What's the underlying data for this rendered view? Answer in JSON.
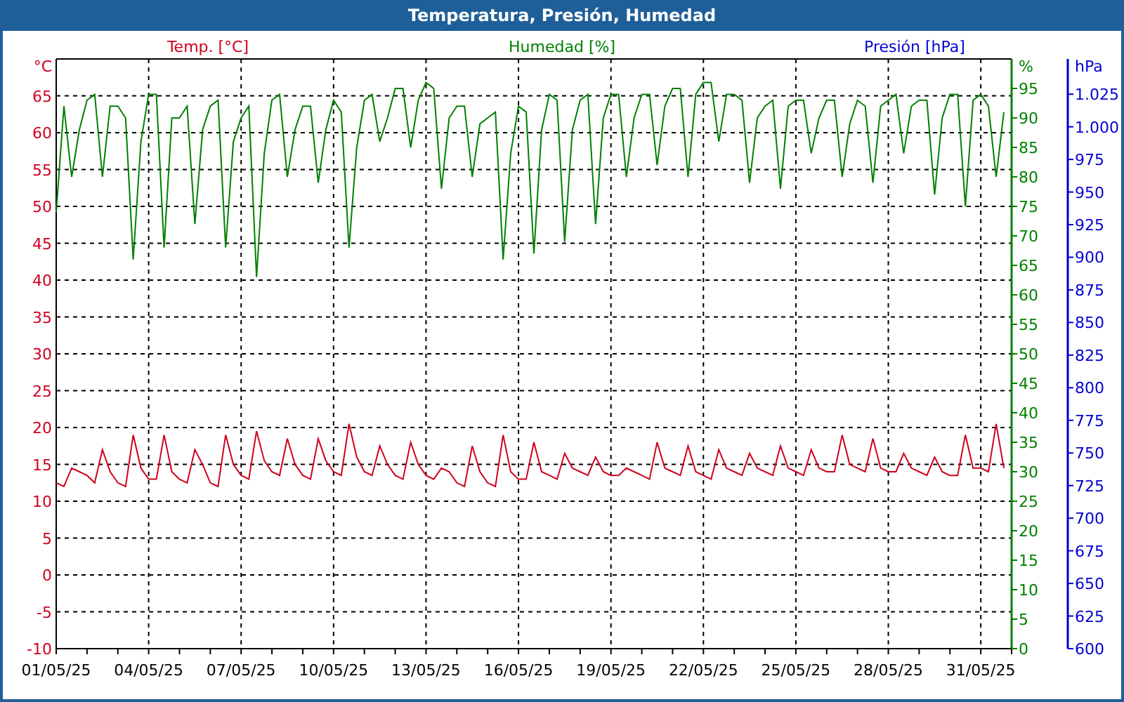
{
  "window": {
    "title": "Temperatura, Presión, Humedad"
  },
  "pressure_title": {
    "text": "Presión [hPa]",
    "color": "#0000d0"
  },
  "chart_data": {
    "type": "line",
    "grid": true,
    "ylabel": "°C",
    "ylim": [
      -10,
      70
    ],
    "y2label": "%",
    "y2lim": [
      0,
      100
    ],
    "y2ticks": [
      0,
      5,
      10,
      15,
      20,
      25,
      30,
      35,
      40,
      45,
      50,
      55,
      60,
      65,
      70,
      75,
      80,
      85,
      90,
      95
    ],
    "y3label": "hPa",
    "y3lim": [
      600,
      1052
    ],
    "y3ticks": [
      {
        "value": 1025,
        "label": "1.025"
      },
      {
        "value": 1000,
        "label": "1.000"
      },
      975,
      950,
      925,
      900,
      875,
      850,
      825,
      800,
      775,
      750,
      725,
      700,
      675,
      650,
      625,
      600
    ],
    "yticks": [
      -10,
      -5,
      0,
      5,
      10,
      15,
      20,
      25,
      30,
      35,
      40,
      45,
      50,
      55,
      60,
      65
    ],
    "categories": [
      "01/05/25",
      null,
      null,
      null,
      null,
      null,
      null,
      null,
      null,
      null,
      null,
      null,
      "04/05/25",
      null,
      null,
      null,
      null,
      null,
      null,
      null,
      null,
      null,
      null,
      null,
      "07/05/25",
      null,
      null,
      null,
      null,
      null,
      null,
      null,
      null,
      null,
      null,
      null,
      "10/05/25",
      null,
      null,
      null,
      null,
      null,
      null,
      null,
      null,
      null,
      null,
      null,
      "13/05/25",
      null,
      null,
      null,
      null,
      null,
      null,
      null,
      null,
      null,
      null,
      null,
      "16/05/25",
      null,
      null,
      null,
      null,
      null,
      null,
      null,
      null,
      null,
      null,
      null,
      "19/05/25",
      null,
      null,
      null,
      null,
      null,
      null,
      null,
      null,
      null,
      null,
      null,
      "22/05/25",
      null,
      null,
      null,
      null,
      null,
      null,
      null,
      null,
      null,
      null,
      null,
      "25/05/25",
      null,
      null,
      null,
      null,
      null,
      null,
      null,
      null,
      null,
      null,
      null,
      "28/05/25",
      null,
      null,
      null,
      null,
      null,
      null,
      null,
      null,
      null,
      null,
      null,
      "31/05/25",
      null,
      null,
      null
    ],
    "series": [
      {
        "name": "Temp. [°C]",
        "color": "#d0001e",
        "values": [
          12.5,
          12,
          14.5,
          14,
          13.5,
          12.5,
          17,
          14,
          12.5,
          12,
          19,
          14.5,
          13,
          13,
          19,
          14,
          13,
          12.5,
          17,
          15,
          12.5,
          12,
          19,
          15,
          13.5,
          13,
          19.5,
          15.5,
          14,
          13.5,
          18.5,
          15,
          13.5,
          13,
          18.5,
          15.5,
          14,
          13.5,
          20.5,
          16,
          14,
          13.5,
          17.5,
          15,
          13.5,
          13,
          18,
          15,
          13.5,
          13,
          14.5,
          14,
          12.5,
          12,
          17.5,
          14,
          12.5,
          12,
          19,
          14,
          13,
          13,
          18,
          14,
          13.5,
          13,
          16.5,
          14.5,
          14,
          13.5,
          16,
          14,
          13.5,
          13.5,
          14.5,
          14,
          13.5,
          13,
          18,
          14.5,
          14,
          13.5,
          17.5,
          14,
          13.5,
          13,
          17,
          14.5,
          14,
          13.5,
          16.5,
          14.5,
          14,
          13.5,
          17.5,
          14.5,
          14,
          13.5,
          17,
          14.5,
          14,
          14,
          19,
          15,
          14.5,
          14,
          18.5,
          14.5,
          14,
          14,
          16.5,
          14.5,
          14,
          13.5,
          16,
          14,
          13.5,
          13.5,
          19,
          14.5,
          14.5,
          14,
          20.5,
          14.5
        ]
      },
      {
        "name": "Humedad [%]",
        "color": "#008000",
        "axis": "y2",
        "values": [
          74,
          92,
          80,
          88,
          93,
          94,
          80,
          92,
          92,
          90,
          66,
          86,
          94,
          94,
          68,
          90,
          90,
          92,
          72,
          88,
          92,
          93,
          68,
          86,
          90,
          92,
          63,
          84,
          93,
          94,
          80,
          88,
          92,
          92,
          79,
          88,
          93,
          91,
          68,
          85,
          93,
          94,
          86,
          90,
          95,
          95,
          85,
          93,
          96,
          95,
          78,
          90,
          92,
          92,
          80,
          89,
          90,
          91,
          66,
          84,
          92,
          91,
          67,
          88,
          94,
          93,
          69,
          88,
          93,
          94,
          72,
          90,
          94,
          94,
          80,
          90,
          94,
          94,
          82,
          92,
          95,
          95,
          80,
          94,
          96,
          96,
          86,
          94,
          94,
          93,
          79,
          90,
          92,
          93,
          78,
          92,
          93,
          93,
          84,
          90,
          93,
          93,
          80,
          89,
          93,
          92,
          79,
          92,
          93,
          94,
          84,
          92,
          93,
          93,
          77,
          90,
          94,
          94,
          75,
          93,
          94,
          92,
          80,
          91
        ]
      }
    ]
  }
}
